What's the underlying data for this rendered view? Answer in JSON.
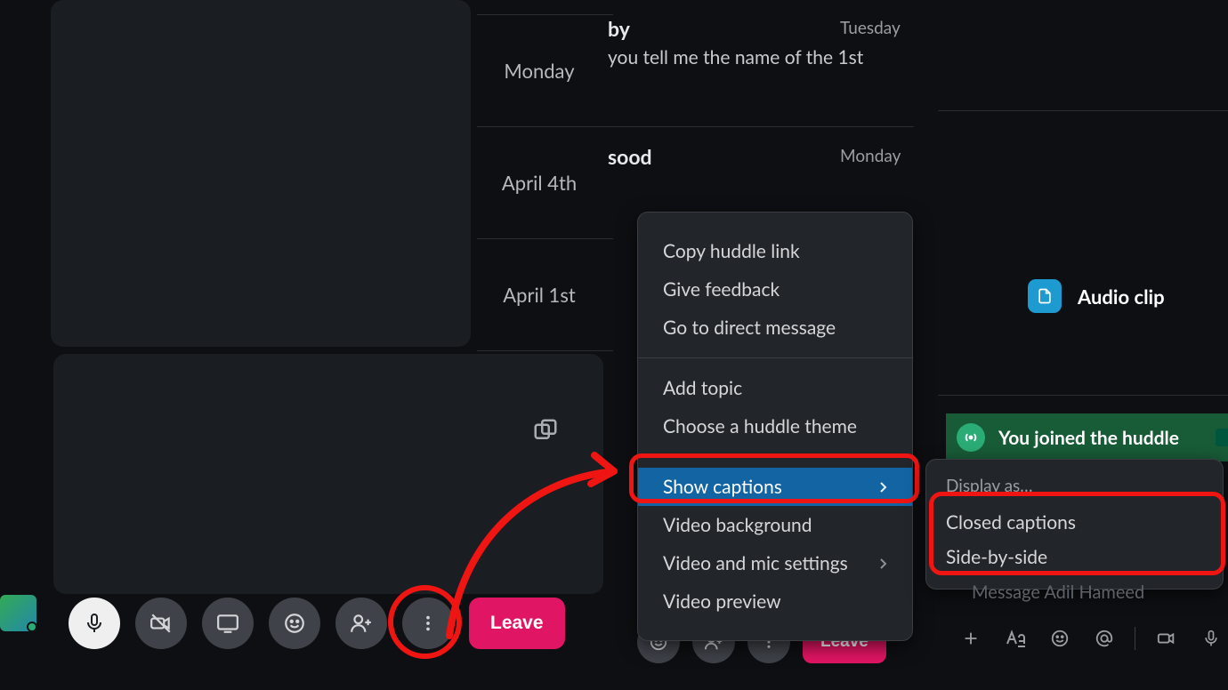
{
  "left": {
    "dates": [
      "Monday",
      "April 4th",
      "April 1st"
    ],
    "toolbar": {
      "mic": "microphone-icon",
      "camera": "camera-off-icon",
      "share": "screen-share-icon",
      "emoji": "emoji-icon",
      "invite": "person-add-icon",
      "more": "more-icon",
      "leave_label": "Leave"
    }
  },
  "mid": {
    "msg1": {
      "name_fragment": "by",
      "date": "Tuesday",
      "text": "you tell me the name of the 1st"
    },
    "msg2": {
      "name_fragment": "sood",
      "date": "Monday"
    },
    "toolbar": {
      "leave_label": "Leave"
    }
  },
  "menu": {
    "items_group1": [
      "Copy huddle link",
      "Give feedback",
      "Go to direct message"
    ],
    "items_group2": [
      "Add topic",
      "Choose a huddle theme"
    ],
    "items_group3": [
      {
        "label": "Show captions",
        "submenu": true,
        "highlight": true
      },
      {
        "label": "Video background"
      },
      {
        "label": "Video and mic settings",
        "submenu": true
      },
      {
        "label": "Video preview"
      }
    ]
  },
  "right": {
    "audio_clip_label": "Audio clip",
    "joined_text": "You joined the huddle",
    "submenu": {
      "title": "Display as…",
      "items": [
        "Closed captions",
        "Side-by-side"
      ]
    },
    "composer_placeholder": "Message Adil Hameed"
  }
}
